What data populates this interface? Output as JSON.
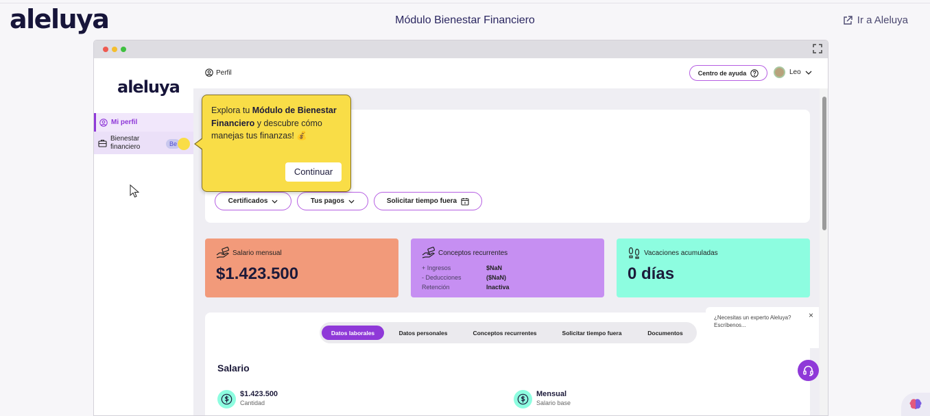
{
  "app": {
    "brand": "aleluya",
    "page_title": "Módulo Bienestar Financiero",
    "go_link": "Ir a Aleluya"
  },
  "sidebar": {
    "logo": "aleluya",
    "items": [
      {
        "label": "Mi perfil",
        "icon": "user-circle-icon"
      },
      {
        "label": "Bienestar financiero",
        "icon": "briefcase-icon",
        "badge": "Be"
      }
    ]
  },
  "topbar": {
    "perfil": "Perfil",
    "help": "Centro de ayuda",
    "user": "Leo"
  },
  "hero": {
    "buttons": [
      "Certificados",
      "Tus pagos",
      "Solicitar tiempo fuera"
    ]
  },
  "cards": [
    {
      "title": "Salario mensual",
      "value": "$1.423.500",
      "color": "#f29a7a"
    },
    {
      "title": "Conceptos recurrentes",
      "color": "#c68ff2",
      "rows": [
        {
          "label": "+ Ingresos",
          "value": "$NaN"
        },
        {
          "label": "- Deducciones",
          "value": "($NaN)"
        },
        {
          "label": "Retención",
          "value": "Inactiva"
        }
      ]
    },
    {
      "title": "Vacaciones acumuladas",
      "value": "0 días",
      "color": "#8dfde0"
    }
  ],
  "tabs": [
    "Datos laborales",
    "Datos personales",
    "Conceptos recurrentes",
    "Solicitar tiempo fuera",
    "Documentos"
  ],
  "salary": {
    "title": "Salario",
    "items": [
      {
        "value": "$1.423.500",
        "label": "Cantidad"
      },
      {
        "value": "Mensual",
        "label": "Salario base"
      }
    ]
  },
  "tooltip": {
    "pre": "Explora tu ",
    "bold": "Módulo de Bienestar Financiero",
    "post": " y descubre cómo manejas tus finanzas! 💰",
    "button": "Continuar"
  },
  "expert": {
    "text": "¿Necesitas un experto Aleluya? Escríbenos...",
    "close": "×"
  },
  "colors": {
    "accent": "#8f39d8",
    "tooltip": "#f9dd47"
  }
}
